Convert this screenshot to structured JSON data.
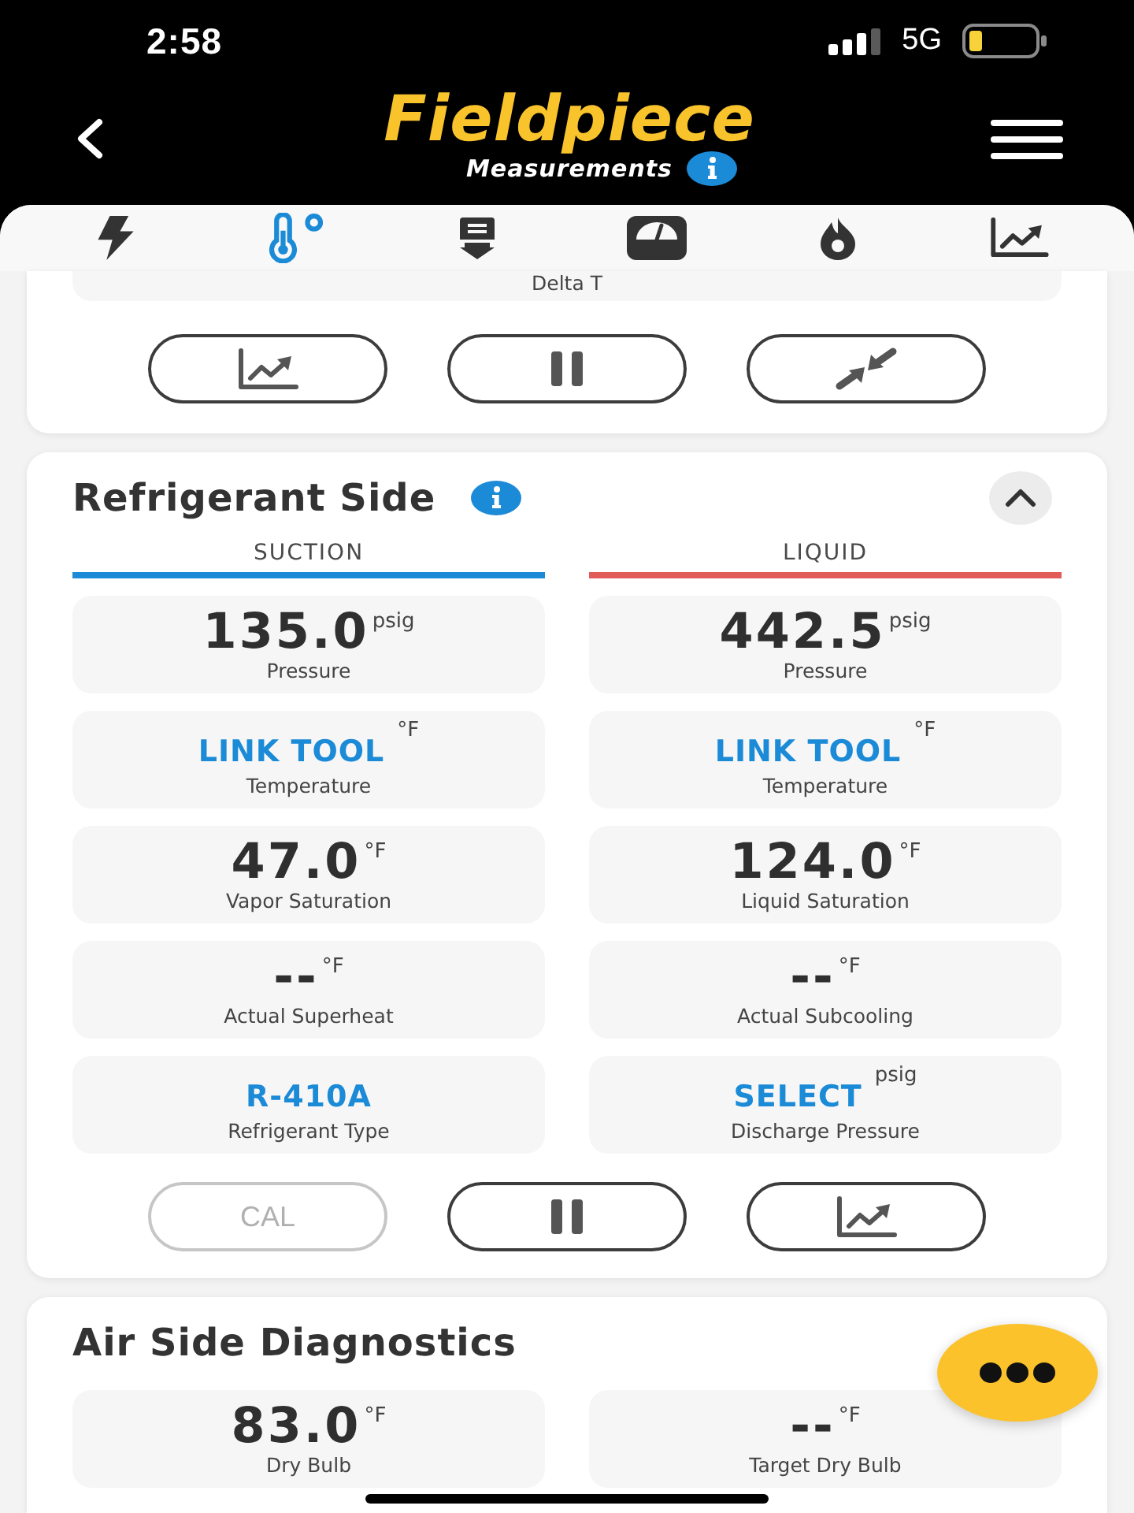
{
  "status_bar": {
    "time": "2:58",
    "network": "5G"
  },
  "header": {
    "logo": "Fieldpiece",
    "subtitle": "Measurements"
  },
  "tabs": [
    {
      "selected": false
    },
    {
      "selected": true
    },
    {
      "selected": false
    },
    {
      "selected": false
    },
    {
      "selected": false
    },
    {
      "selected": false
    }
  ],
  "delta_t_panel": {
    "tiles": [
      {
        "label": "Delta T"
      }
    ],
    "buttons": [
      {
        "kind": "chart",
        "disabled": false
      },
      {
        "kind": "pause",
        "disabled": false
      },
      {
        "kind": "collapse",
        "disabled": false
      }
    ]
  },
  "refrigerant_side": {
    "title": "Refrigerant Side",
    "expanded": true,
    "columns": [
      {
        "heading": "SUCTION",
        "color": "#1b8ad7",
        "tiles": [
          {
            "kind": "reading",
            "value": "135.0",
            "unit": "psig",
            "label": "Pressure"
          },
          {
            "kind": "link",
            "value": "LINK TOOL",
            "unit": "°F",
            "label": "Temperature"
          },
          {
            "kind": "reading",
            "value": "47.0",
            "unit": "°F",
            "label": "Vapor Saturation"
          },
          {
            "kind": "reading",
            "value": "--",
            "unit": "°F",
            "label": "Actual Superheat"
          },
          {
            "kind": "link",
            "value": "R-410A",
            "label": "Refrigerant Type"
          }
        ]
      },
      {
        "heading": "LIQUID",
        "color": "#e15b58",
        "tiles": [
          {
            "kind": "reading",
            "value": "442.5",
            "unit": "psig",
            "label": "Pressure"
          },
          {
            "kind": "link",
            "value": "LINK TOOL",
            "unit": "°F",
            "label": "Temperature"
          },
          {
            "kind": "reading",
            "value": "124.0",
            "unit": "°F",
            "label": "Liquid Saturation"
          },
          {
            "kind": "reading",
            "value": "--",
            "unit": "°F",
            "label": "Actual Subcooling"
          },
          {
            "kind": "link",
            "value": "SELECT",
            "unit": "psig",
            "label": "Discharge Pressure"
          }
        ]
      }
    ],
    "buttons": [
      {
        "kind": "text",
        "label": "CAL",
        "disabled": true
      },
      {
        "kind": "pause",
        "disabled": false
      },
      {
        "kind": "chart",
        "disabled": false
      }
    ]
  },
  "air_side_diagnostics": {
    "title": "Air Side Diagnostics",
    "tiles": [
      {
        "kind": "reading",
        "value": "83.0",
        "unit": "°F",
        "label": "Dry Bulb"
      },
      {
        "kind": "reading",
        "value": "--",
        "unit": "°F",
        "label": "Target Dry Bulb"
      }
    ]
  }
}
